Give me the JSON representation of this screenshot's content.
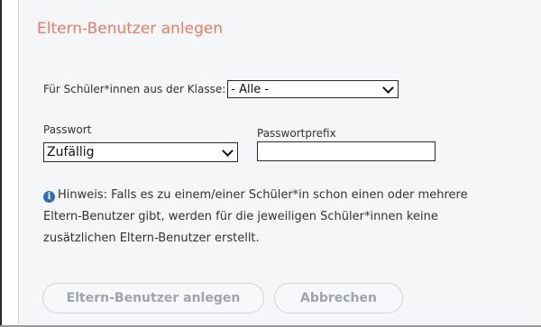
{
  "dialog": {
    "title": "Eltern-Benutzer anlegen"
  },
  "form": {
    "class_label": "Für Schüler*innen aus der Klasse:",
    "class_selected": "- Alle -",
    "password_label": "Passwort",
    "password_selected": "Zufällig",
    "prefix_label": "Passwortprefix",
    "prefix_value": ""
  },
  "hint": {
    "line1": "Hinweis: Falls es zu einem/einer Schüler*in schon einen oder mehrere",
    "line2": "Eltern-Benutzer gibt, werden für die jeweiligen Schüler*innen keine",
    "line3": "zusätzlichen Eltern-Benutzer erstellt.",
    "icon_glyph": "i"
  },
  "buttons": {
    "create_label": "Eltern-Benutzer anlegen",
    "cancel_label": "Abbrechen"
  },
  "colors": {
    "title": "#e77d64",
    "info_icon": "#2f6fb3",
    "dialog_background": "#f5f6f8",
    "disabled_button_text": "#9ea4ad"
  }
}
